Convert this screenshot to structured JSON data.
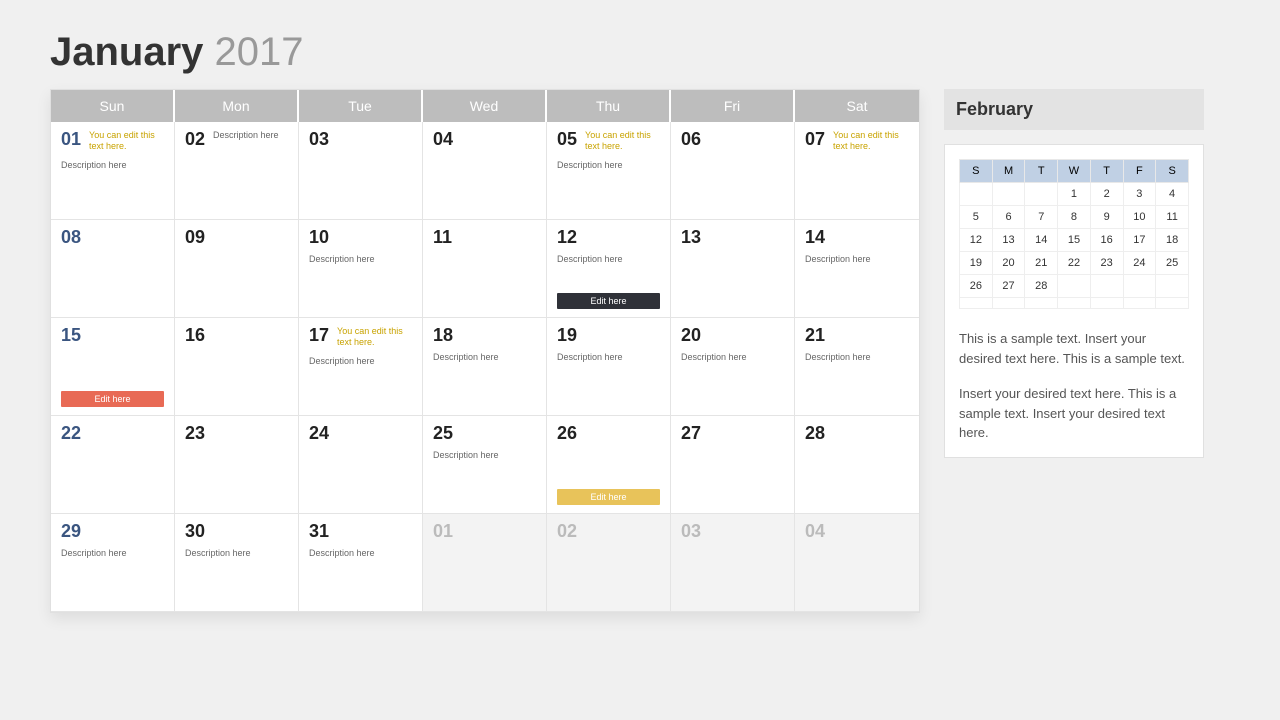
{
  "title_month": "January",
  "title_year": "2017",
  "weekdays": [
    "Sun",
    "Mon",
    "Tue",
    "Wed",
    "Thu",
    "Fri",
    "Sat"
  ],
  "hint_text": "You can edit this text here.",
  "desc_text": "Description here",
  "edit_text": "Edit here",
  "days": [
    {
      "n": "01",
      "sun": true,
      "hint": true,
      "desc_below": true
    },
    {
      "n": "02",
      "desc_inline": true
    },
    {
      "n": "03"
    },
    {
      "n": "04"
    },
    {
      "n": "05",
      "hint": true,
      "desc_below": true
    },
    {
      "n": "06"
    },
    {
      "n": "07",
      "hint": true
    },
    {
      "n": "08",
      "sun": true
    },
    {
      "n": "09"
    },
    {
      "n": "10",
      "desc_below": true
    },
    {
      "n": "11"
    },
    {
      "n": "12",
      "desc_below": true,
      "badge": "dark"
    },
    {
      "n": "13"
    },
    {
      "n": "14",
      "desc_below": true
    },
    {
      "n": "15",
      "sun": true,
      "badge": "red"
    },
    {
      "n": "16"
    },
    {
      "n": "17",
      "hint": true,
      "desc_below": true
    },
    {
      "n": "18",
      "desc_below": true
    },
    {
      "n": "19",
      "desc_below": true
    },
    {
      "n": "20",
      "desc_below": true
    },
    {
      "n": "21",
      "desc_below": true
    },
    {
      "n": "22",
      "sun": true
    },
    {
      "n": "23"
    },
    {
      "n": "24"
    },
    {
      "n": "25",
      "desc_below": true
    },
    {
      "n": "26",
      "badge": "yellow"
    },
    {
      "n": "27"
    },
    {
      "n": "28"
    },
    {
      "n": "29",
      "sun": true,
      "desc_below": true
    },
    {
      "n": "30",
      "desc_below": true
    },
    {
      "n": "31",
      "desc_below": true
    },
    {
      "n": "01",
      "other": true
    },
    {
      "n": "02",
      "other": true
    },
    {
      "n": "03",
      "other": true
    },
    {
      "n": "04",
      "other": true
    }
  ],
  "side": {
    "title": "February",
    "heads": [
      "S",
      "M",
      "T",
      "W",
      "T",
      "F",
      "S"
    ],
    "weeks": [
      [
        "",
        "",
        "",
        "1",
        "2",
        "3",
        "4"
      ],
      [
        "5",
        "6",
        "7",
        "8",
        "9",
        "10",
        "11"
      ],
      [
        "12",
        "13",
        "14",
        "15",
        "16",
        "17",
        "18"
      ],
      [
        "19",
        "20",
        "21",
        "22",
        "23",
        "24",
        "25"
      ],
      [
        "26",
        "27",
        "28",
        "",
        "",
        "",
        ""
      ],
      [
        "",
        "",
        "",
        "",
        "",
        "",
        ""
      ]
    ],
    "para1": "This is a sample text. Insert your desired text here. This is a sample text.",
    "para2": "Insert your desired text here. This is a sample text. Insert your desired text here."
  }
}
